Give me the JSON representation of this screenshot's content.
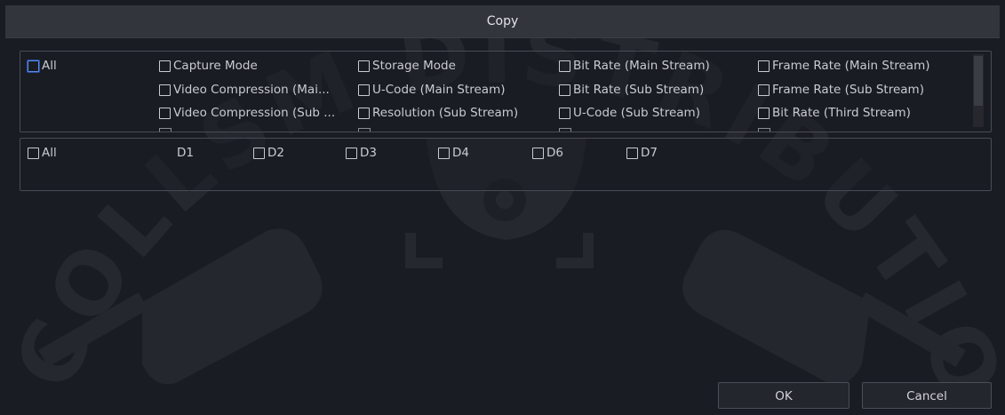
{
  "dialog": {
    "title": "Copy"
  },
  "params": {
    "all_label": "All",
    "items": [
      "Capture Mode",
      "Storage Mode",
      "Bit Rate (Main Stream)",
      "Frame Rate (Main Stream)",
      "Video Compression (Mai...",
      "U-Code (Main Stream)",
      "Bit Rate (Sub Stream)",
      "Frame Rate (Sub Stream)",
      "Video Compression (Sub ...",
      "Resolution (Sub Stream)",
      "U-Code (Sub Stream)",
      "Bit Rate (Third Stream)"
    ]
  },
  "channels": {
    "all_label": "All",
    "items": [
      "D1",
      "D2",
      "D3",
      "D4",
      "D6",
      "D7"
    ]
  },
  "buttons": {
    "ok": "OK",
    "cancel": "Cancel"
  },
  "colors": {
    "background": "#1a1c23",
    "titlebar": "#33353c",
    "accent_checkbox": "#5b8de8"
  },
  "watermark": {
    "text": "COLLSM DISTRIBUTION, INC."
  }
}
